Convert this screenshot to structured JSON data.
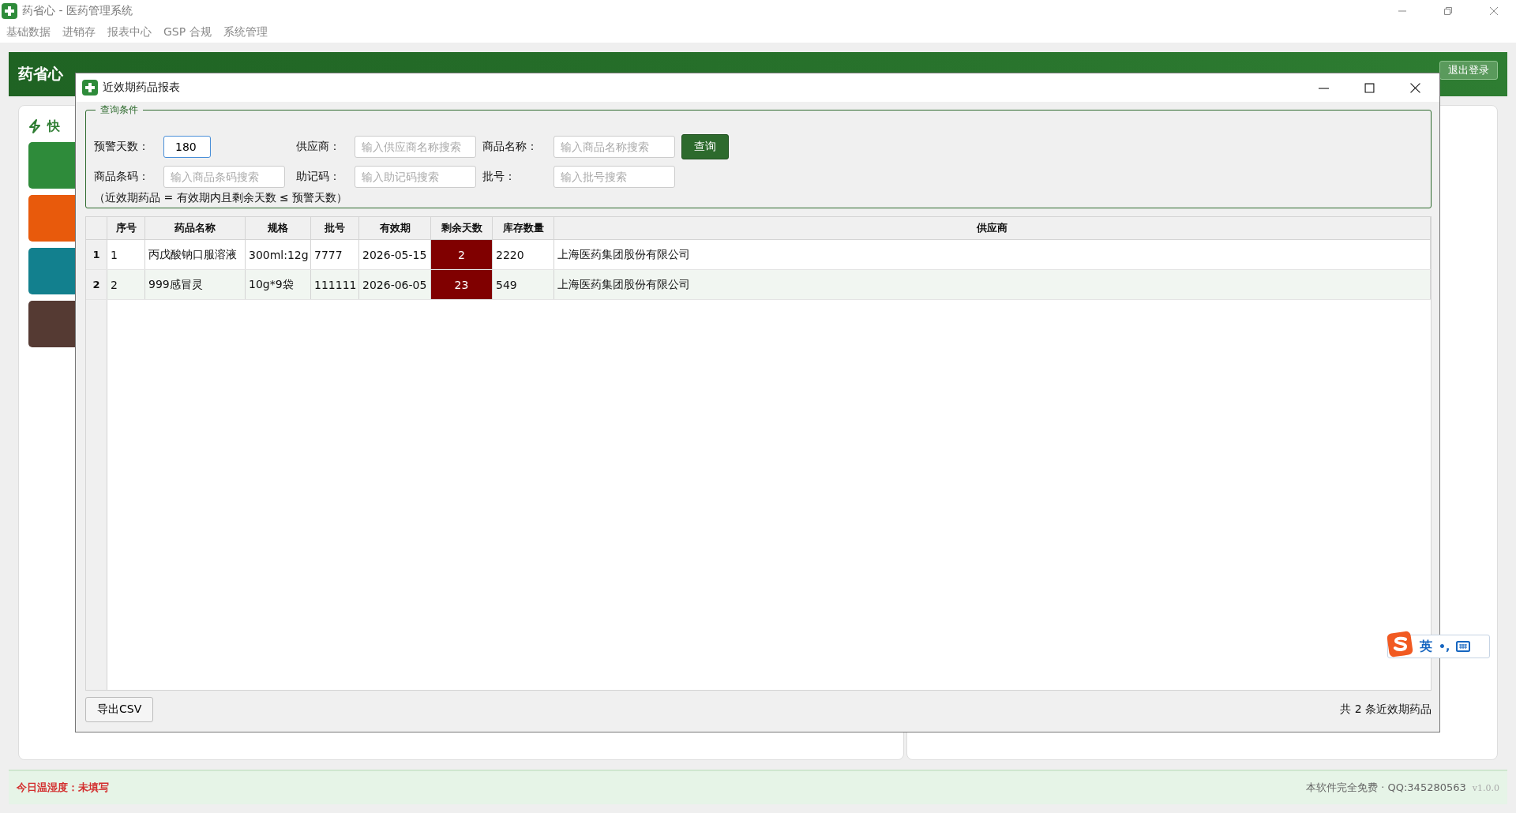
{
  "app_window": {
    "title": "药省心 - 医药管理系统"
  },
  "menu": [
    "基础数据",
    "进销存",
    "报表中心",
    "GSP 合规",
    "系统管理"
  ],
  "header": {
    "title": "药省心",
    "logout_button": "退出登录"
  },
  "quick_panel": {
    "title": "快",
    "tiles": [
      {
        "color": "#2e8b3a"
      },
      {
        "color": "#e85a0c"
      },
      {
        "color": "#12808e"
      },
      {
        "color": "#553a33"
      }
    ]
  },
  "dialog": {
    "title": "近效期药品报表",
    "group_title": "查询条件",
    "fields": [
      {
        "label": "预警天数：",
        "value": "180",
        "focused": true
      },
      {
        "label": "供应商：",
        "placeholder": "输入供应商名称搜索",
        "focused": false
      },
      {
        "label": "商品名称：",
        "placeholder": "输入商品名称搜索",
        "focused": false
      },
      {
        "label": "商品条码：",
        "placeholder": "输入商品条码搜索",
        "focused": false
      },
      {
        "label": "助记码：",
        "placeholder": "输入助记码搜索",
        "focused": false
      },
      {
        "label": "批号：",
        "placeholder": "输入批号搜索",
        "focused": false
      }
    ],
    "search_button": "查询",
    "note": "（近效期药品 = 有效期内且剩余天数 ≤ 预警天数）",
    "table": {
      "columns": [
        "序号",
        "药品名称",
        "规格",
        "批号",
        "有效期",
        "剩余天数",
        "库存数量",
        "供应商"
      ],
      "rows": [
        {
          "row_number": "1",
          "cells": [
            "1",
            "丙戊酸钠口服溶液",
            "300ml:12g",
            "7777",
            "2026-05-15",
            "2",
            "2220",
            "上海医药集团股份有限公司"
          ],
          "expiring": true
        },
        {
          "row_number": "2",
          "cells": [
            "2",
            "999感冒灵",
            "10g*9袋",
            "111111",
            "2026-06-05",
            "23",
            "549",
            "上海医药集团股份有限公司"
          ],
          "expiring": true
        }
      ]
    },
    "export_button": "导出CSV",
    "summary": "共 2 条近效期药品"
  },
  "ime": {
    "mode": "英",
    "punctuation": "•,"
  },
  "footer": {
    "status": "今日温湿度：未填写",
    "info": "本软件完全免费 · QQ:345280563",
    "version": "v1.0.0"
  }
}
